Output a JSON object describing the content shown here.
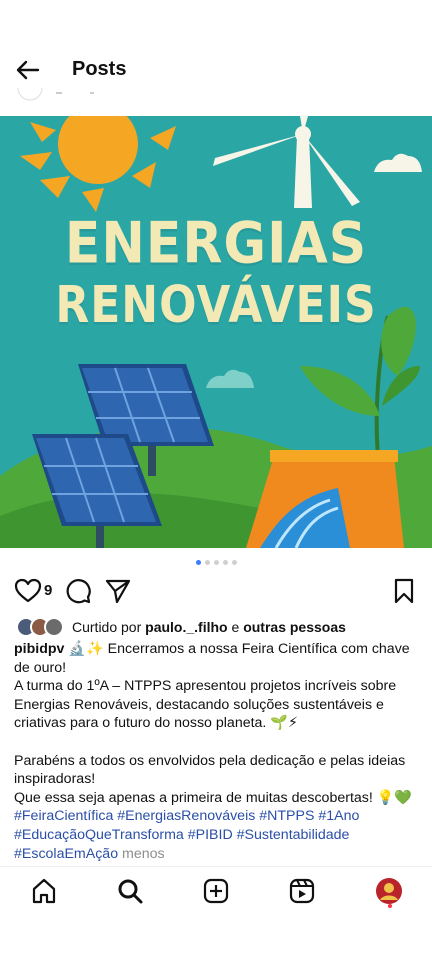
{
  "header": {
    "title": "Posts",
    "back_icon": "arrow-left-icon"
  },
  "post": {
    "image": {
      "title_line1": "ENERGIAS",
      "title_line2": "RENOVÁVEIS",
      "colors": {
        "sky": "#2aa6a5",
        "sun": "#f5a623",
        "grass": "#4fa83a",
        "panel": "#2e67b0",
        "title": "#f2e9b4"
      }
    },
    "carousel": {
      "total": 5,
      "active": 0
    },
    "actions": {
      "like_icon": "heart-icon",
      "like_count": "9",
      "comment_icon": "comment-icon",
      "share_icon": "send-icon",
      "save_icon": "bookmark-icon"
    },
    "liked_by": {
      "prefix": "Curtido por",
      "user": "paulo._.filho",
      "connector": "e",
      "others": "outras pessoas"
    },
    "caption": {
      "username": "pibidpv",
      "line1_rest": "🔬✨ Encerramos a nossa Feira Científica com chave",
      "line2": "de ouro!",
      "line3": "A turma do 1ºA – NTPPS apresentou projetos incríveis sobre",
      "line4": "Energias Renováveis, destacando soluções sustentáveis e",
      "line5": "criativas para o futuro do nosso planeta. 🌱⚡",
      "line6": "Parabéns a todos os envolvidos pela dedicação e pelas ideias",
      "line7": "inspiradoras!",
      "line8": "Que essa seja apenas a primeira de muitas descobertas! 💡💚",
      "tags1": "#FeiraCientífica #EnergiasRenováveis #NTPPS #1Ano",
      "tags2": "#EducaçãoQueTransforma #PIBID #Sustentabilidade",
      "tags3": "#EscolaEmAção",
      "more": "menos"
    }
  },
  "bottom_nav": {
    "home_icon": "home-icon",
    "search_icon": "search-icon",
    "create_icon": "plus-square-icon",
    "reels_icon": "reels-icon",
    "profile_icon": "avatar"
  }
}
